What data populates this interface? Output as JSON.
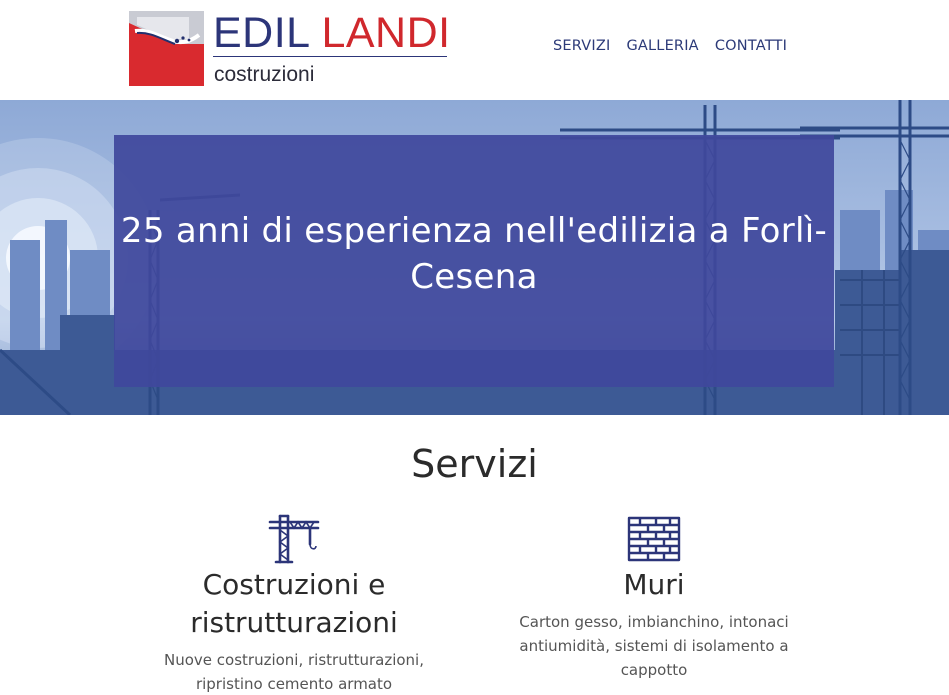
{
  "header": {
    "brand": {
      "name_part1": "EDIL",
      "name_part2": "LANDI",
      "subtitle": "costruzioni"
    },
    "nav": [
      {
        "label": "SERVIZI"
      },
      {
        "label": "GALLERIA"
      },
      {
        "label": "CONTATTI"
      }
    ]
  },
  "hero": {
    "title": "25 anni di esperienza nell'edilizia a Forlì-Cesena"
  },
  "services": {
    "title": "Servizi",
    "items": [
      {
        "icon": "crane-icon",
        "title": "Costruzioni e ristrutturazioni",
        "description": "Nuove costruzioni, ristrutturazioni, ripristino cemento armato"
      },
      {
        "icon": "brick-wall-icon",
        "title": "Muri",
        "description": "Carton gesso, imbianchino, intonaci antiumidità, sistemi di isolamento a cappotto"
      }
    ]
  },
  "colors": {
    "brand_blue": "#2c3579",
    "brand_red": "#d0282d",
    "nav_text": "#2c3a78",
    "hero_overlay": "#40489c"
  }
}
